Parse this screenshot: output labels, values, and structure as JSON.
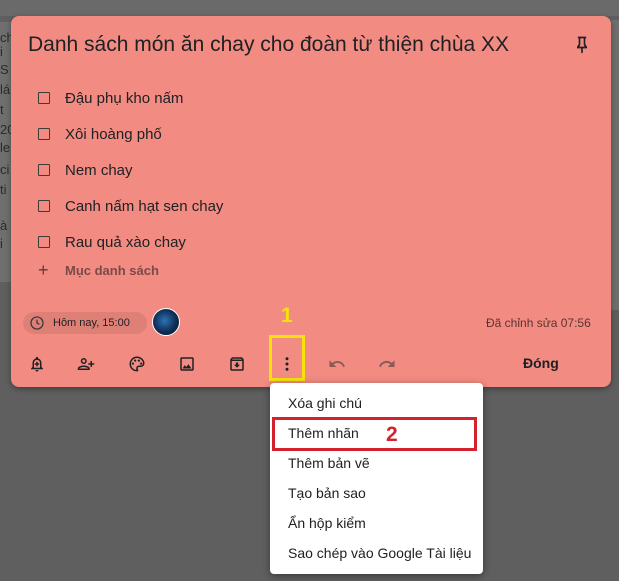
{
  "background": {
    "left_fragments": [
      "ch",
      "i",
      "S",
      "lá",
      "t",
      "20",
      "le",
      "ci",
      "ti",
      "à",
      "i"
    ]
  },
  "note": {
    "title": "Danh sách món ăn chay cho đoàn từ thiện chùa XX",
    "items": [
      {
        "label": "Đậu phụ kho nấm",
        "checked": false
      },
      {
        "label": "Xôi hoàng phố",
        "checked": false
      },
      {
        "label": "Nem chay",
        "checked": false
      },
      {
        "label": "Canh nấm hạt sen chay",
        "checked": false
      },
      {
        "label": "Rau quả xào chay",
        "checked": false
      }
    ],
    "add_item_placeholder": "Mục danh sách",
    "reminder": "Hôm nay, 15:00",
    "edited": "Đã chỉnh sửa 07:56",
    "close_label": "Đóng",
    "color": "#f28b82"
  },
  "toolbar": {
    "icons": [
      "bell-plus-icon",
      "person-add-icon",
      "palette-icon",
      "image-icon",
      "archive-icon",
      "more-vert-icon",
      "undo-icon",
      "redo-icon"
    ]
  },
  "annotations": {
    "step1": "1",
    "step2": "2",
    "step1_color": "#f6e20b",
    "step2_color": "#d4212c"
  },
  "menu": {
    "items": [
      "Xóa ghi chú",
      "Thêm nhãn",
      "Thêm bản vẽ",
      "Tạo bản sao",
      "Ẩn hộp kiểm",
      "Sao chép vào Google Tài liệu"
    ]
  }
}
